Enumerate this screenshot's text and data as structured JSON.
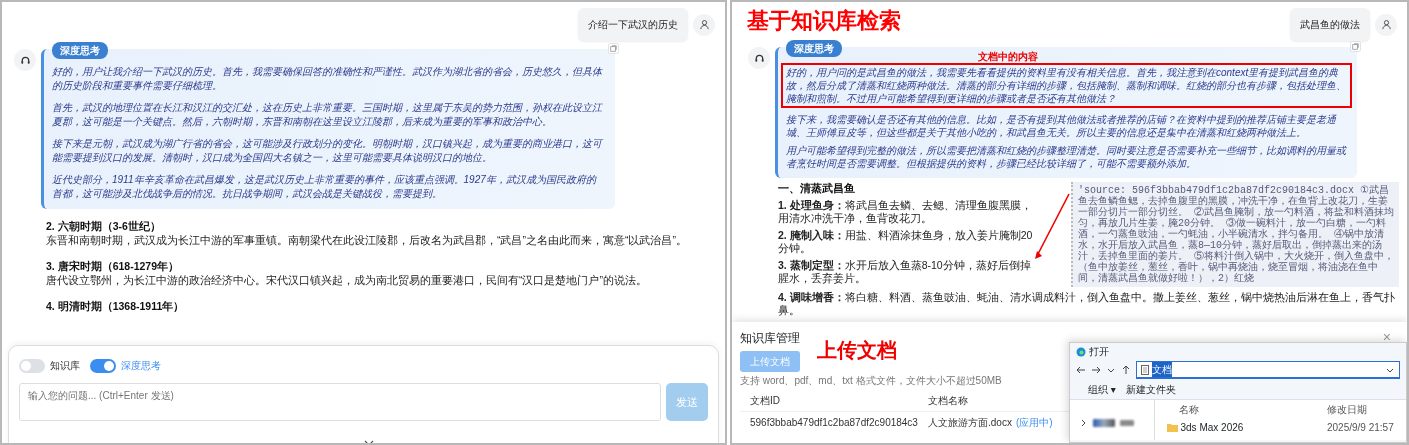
{
  "left_chat": {
    "user_message": "介绍一下武汉的历史",
    "thinking": {
      "badge": "深度思考",
      "paragraphs": [
        "好的，用户让我介绍一下武汉的历史。首先，我需要确保回答的准确性和严谨性。武汉作为湖北省的省会，历史悠久，但具体的历史阶段和重要事件需要仔细梳理。",
        "首先，武汉的地理位置在长江和汉江的交汇处，这在历史上非常重要。三国时期，这里属于东吴的势力范围，孙权在此设立江夏郡，这可能是一个关键点。然后，六朝时期，东晋和南朝在这里设立江陵郡，后来成为重要的军事和政治中心。",
        "接下来是元朝，武汉成为湖广行省的省会，这可能涉及行政划分的变化。明朝时期，汉口镇兴起，成为重要的商业港口，这可能需要提到汉口的发展。清朝时，汉口成为全国四大名镇之一，这里可能需要具体说明汉口的地位。",
        "近代史部分，1911年辛亥革命在武昌爆发，这是武汉历史上非常重要的事件，应该重点强调。1927年，武汉成为国民政府的首都，这可能涉及北伐战争后的情况。抗日战争期间，武汉会战是关键战役，需要提到。"
      ]
    },
    "sections": [
      {
        "heading": "2. 六朝时期（3-6世纪）",
        "text": "东晋和南朝时期，武汉成为长江中游的军事重镇。南朝梁代在此设江陵郡，后改名为武昌郡，“武昌”之名由此而来，寓意“以武治昌”。"
      },
      {
        "heading": "3. 唐宋时期（618-1279年）",
        "text": "唐代设立鄂州，为长江中游的政治经济中心。宋代汉口镇兴起，成为南北贸易的重要港口，民间有“汉口是楚地门户”的说法。"
      },
      {
        "heading": "4. 明清时期（1368-1911年）"
      }
    ],
    "composer": {
      "toggles": [
        {
          "label": "知识库",
          "on": false
        },
        {
          "label": "深度思考",
          "on": true
        }
      ],
      "placeholder": "输入您的问题... (Ctrl+Enter 发送)",
      "send_button": "发送",
      "send_disabled": true
    }
  },
  "right_chat": {
    "user_message": "武昌鱼的做法",
    "thinking": {
      "badge": "深度思考",
      "paragraphs": [
        "好的，用户问的是武昌鱼的做法，我需要先看看提供的资料里有没有相关信息。首先，我注意到在context里有提到武昌鱼的典故，然后分成了清蒸和红烧两种做法。清蒸的部分有详细的步骤，包括腌制、蒸制和调味。红烧的部分也有步骤，包括处理鱼、腌制和煎制。不过用户可能希望得到更详细的步骤或者是否还有其他做法？",
        "接下来，我需要确认是否还有其他的信息。比如，是否有提到其他做法或者推荐的店铺？在资料中提到的推荐店铺主要是老通城、王师傅豆皮等，但这些都是关于其他小吃的，和武昌鱼无关。所以主要的信息还是集中在清蒸和红烧两种做法上。",
        "用户可能希望得到完整的做法，所以需要把清蒸和红烧的步骤整理清楚。同时要注意是否需要补充一些细节，比如调料的用量或者烹饪时间是否需要调整。但根据提供的资料，步骤已经比较详细了，可能不需要额外添加。"
      ]
    },
    "heading": "一、清蒸武昌鱼",
    "steps": [
      "**1. 处理鱼身：**将武昌鱼去鳞、去鳃、清理鱼腹黑膜，用清水冲洗干净，鱼背改花刀。",
      "**2. 腌制入味：**用盐、料酒涂抹鱼身，放入姜片腌制20分钟。",
      "**3. 蒸制定型：**水开后放入鱼蒸8-10分钟，蒸好后倒掉腥水，丢弃姜片。",
      "**4. 调味增香：**将白糖、料酒、蒸鱼豉油、蚝油、清水调成料汁，倒入鱼盘中。撒上姜丝、葱丝，锅中烧热油后淋在鱼上，香气扑鼻。"
    ],
    "source_snippet": "'source: 596f3bbab479df1c2ba87df2c90184c3.docx ①武昌鱼去鱼鳞鱼鳃，去掉鱼腹里的黑膜，冲洗干净，在鱼背上改花刀，生姜一部分切片一部分切丝。 ②武昌鱼腌制，放一勺料酒，将盐和料酒抹均匀，再放几片生姜，腌20分钟。 ③做一碗料汁，放一勺白糖，一勺料酒，一勺蒸鱼豉油，一勺蚝油，小半碗清水，拌匀备用。 ④锅中放清水，水开后放入武昌鱼，蒸8—10分钟，蒸好后取出，倒掉蒸出来的汤汁，丢掉鱼里面的姜片。 ⑤将料汁倒入锅中，大火烧开，倒入鱼盘中，（鱼中放姜丝，葱丝，香叶，锅中再烧油，烧至冒烟，将油浇在鱼中间，清蒸武昌鱼就做好啦！），2）红烧"
  },
  "annotations": {
    "title": "基于知识库检索",
    "box_label": "文档中的内容",
    "upload_label": "上传文档"
  },
  "modal": {
    "title": "知识库管理",
    "close": "×",
    "upload_button": "上传文档",
    "hint": "支持 word、pdf、md、txt 格式文件，文件大小不超过50MB",
    "columns": [
      "文档ID",
      "文档名称"
    ],
    "rows": [
      {
        "id": "596f3bbab479df1c2ba87df2c90184c3",
        "name": "人文旅游方面.docx",
        "status": "(应用中)"
      }
    ]
  },
  "file_dialog": {
    "title": "打开",
    "address": "文档",
    "address_selected": true,
    "toolbar": [
      "组织 ▾",
      "新建文件夹"
    ],
    "columns": [
      "名称",
      "修改日期"
    ],
    "rows": [
      {
        "name": "3ds Max 2026",
        "date": "2025/9/9 21:57"
      }
    ]
  }
}
